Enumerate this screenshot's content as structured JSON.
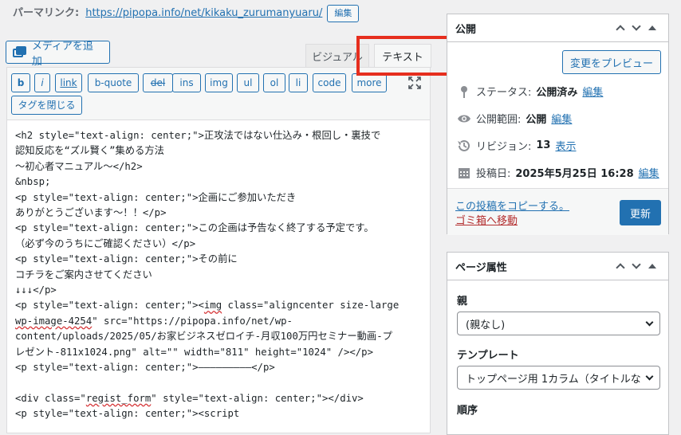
{
  "permalink": {
    "label": "パーマリンク:",
    "url": "https://pipopa.info/net/kikaku_zurumanyuaru/",
    "edit_label": "編集"
  },
  "editor": {
    "add_media_label": "メディアを追加",
    "tabs": {
      "visual": "ビジュアル",
      "text": "テキスト"
    },
    "quicktags": [
      "b",
      "i",
      "link",
      "b-quote",
      "del",
      "ins",
      "img",
      "ul",
      "ol",
      "li",
      "code",
      "more"
    ],
    "close_tags_label": "タグを閉じる",
    "content_lines": [
      "<h2 style=\"text-align: center;\">正攻法ではない仕込み・根回し・裏技で",
      "認知反応を“ズル賢く”集める方法",
      "～初心者マニュアル～</h2>",
      "&nbsp;",
      "<p style=\"text-align: center;\">企画にご参加いただき",
      "ありがとうございます～！！</p>",
      "<p style=\"text-align: center;\">この企画は予告なく終了する予定です。",
      "（必ず今のうちにご確認ください）</p>",
      "<p style=\"text-align: center;\">その前に",
      "コチラをご案内させてください",
      "↓↓↓</p>",
      "<p style=\"text-align: center;\"><img class=\"aligncenter size-large",
      "wp-image-4254\" src=\"https://pipopa.info/net/wp-",
      "content/uploads/2025/05/お家ビジネスゼロイチ-月収100万円セミナー動画-プ",
      "レゼント-811x1024.png\" alt=\"\" width=\"811\" height=\"1024\" /></p>",
      "<p style=\"text-align: center;\">―――――――――</p>",
      "",
      "<div class=\"regist_form\" style=\"text-align: center;\"></div>",
      "<p style=\"text-align: center;\"><script"
    ]
  },
  "publish": {
    "title": "公開",
    "preview_label": "変更をプレビュー",
    "status_label": "ステータス:",
    "status_value": "公開済み",
    "visibility_label": "公開範囲:",
    "visibility_value": "公開",
    "revisions_label": "リビジョン:",
    "revisions_value": "13",
    "revisions_link": "表示",
    "date_label": "投稿日:",
    "date_value": "2025年5月25日 16:28",
    "edit_label": "編集",
    "copy_link": "この投稿をコピーする。",
    "trash_link": "ゴミ箱へ移動",
    "update_label": "更新"
  },
  "page_attributes": {
    "title": "ページ属性",
    "parent_label": "親",
    "parent_value": "(親なし)",
    "template_label": "テンプレート",
    "template_value": "トップページ用 1カラム（タイトルな",
    "order_label": "順序"
  }
}
